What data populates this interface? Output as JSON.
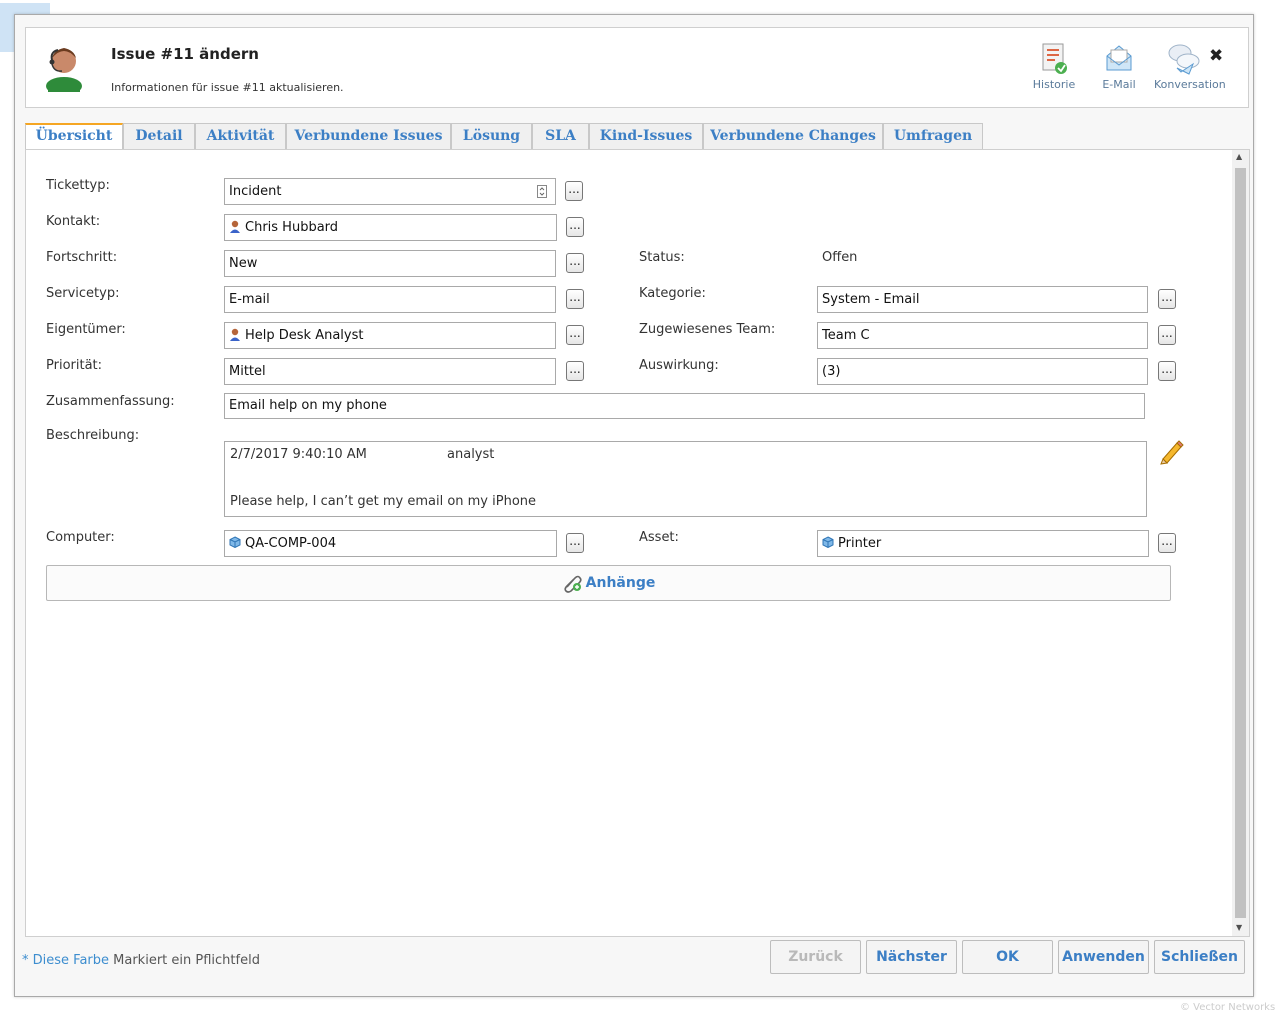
{
  "header": {
    "title": "Issue #11 ändern",
    "subtitle": "Informationen für issue #11 aktualisieren.",
    "history_label": "Historie",
    "email_label": "E-Mail",
    "conversation_label": "Konversation",
    "close_glyph": "✖"
  },
  "tabs": [
    "Übersicht",
    "Detail",
    "Aktivität",
    "Verbundene Issues",
    "Lösung",
    "SLA",
    "Kind-Issues",
    "Verbundene Changes",
    "Umfragen"
  ],
  "active_tab": "Übersicht",
  "form": {
    "tickettyp_label": "Tickettyp:",
    "tickettyp_value": "Incident",
    "kontakt_label": "Kontakt:",
    "kontakt_value": "Chris Hubbard",
    "fortschritt_label": "Fortschritt:",
    "fortschritt_value": "New",
    "status_label": "Status:",
    "status_value": "Offen",
    "servicetyp_label": "Servicetyp:",
    "servicetyp_value": "E-mail",
    "kategorie_label": "Kategorie:",
    "kategorie_value": "System - Email",
    "eigentuemer_label": "Eigentümer:",
    "eigentuemer_value": "Help Desk Analyst",
    "team_label": "Zugewiesenes Team:",
    "team_value": "Team C",
    "prioritaet_label": "Priorität:",
    "prioritaet_value": "Mittel",
    "auswirkung_label": "Auswirkung:",
    "auswirkung_value": "(3)",
    "zusammenfassung_label": "Zusammenfassung:",
    "zusammenfassung_value": "Email help on my phone",
    "beschreibung_label": "Beschreibung:",
    "beschreibung_date": "2/7/2017 9:40:10 AM",
    "beschreibung_author": "analyst",
    "beschreibung_text": "Please help, I can’t get my email on my iPhone",
    "computer_label": "Computer:",
    "computer_value": "QA-COMP-004",
    "asset_label": "Asset:",
    "asset_value": "Printer",
    "browse_label": "..."
  },
  "attachments_label": "Anhänge",
  "footer": {
    "required_prefix": "* Diese Farbe",
    "required_suffix": "Markiert ein Pflichtfeld",
    "back": "Zurück",
    "next": "Nächster",
    "ok": "OK",
    "apply": "Anwenden",
    "close": "Schließen"
  },
  "copyright": "© Vector Networks",
  "colors": {
    "accent": "#3c7fc5",
    "active_tab_border": "#f5a623"
  }
}
